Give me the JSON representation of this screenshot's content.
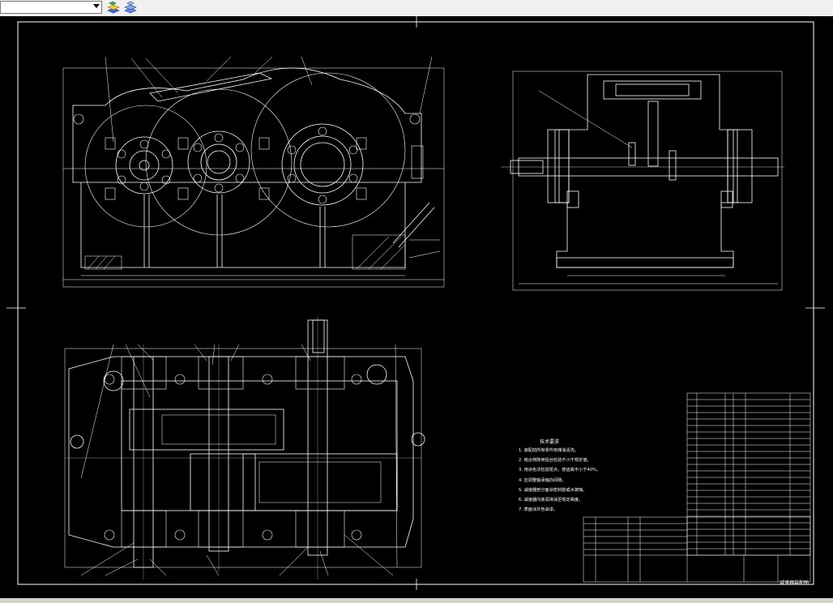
{
  "toolbar": {
    "layer_combo_value": "",
    "icons": [
      "layer-properties-icon",
      "layer-states-icon"
    ]
  },
  "drawing": {
    "tech_title": "技术要求",
    "tech_lines": [
      "1. 装配前所有零件用煤油清洗。",
      "2. 啮合侧隙用铅丝检验不小于规定值。",
      "3. 用涂色法检验斑点，按齿高不小于40%。",
      "4. 应调整轴承轴向间隙。",
      "5. 减速器剖分面涂密封胶或水玻璃。",
      "6. 减速器内装润滑油至规定高度。",
      "7. 表面涂灰色油漆。"
    ],
    "title_block_name": "减速器装配图",
    "colors": {
      "background": "#000000",
      "lines": "#ffffff",
      "toolbar": "#f0f0f0"
    }
  }
}
